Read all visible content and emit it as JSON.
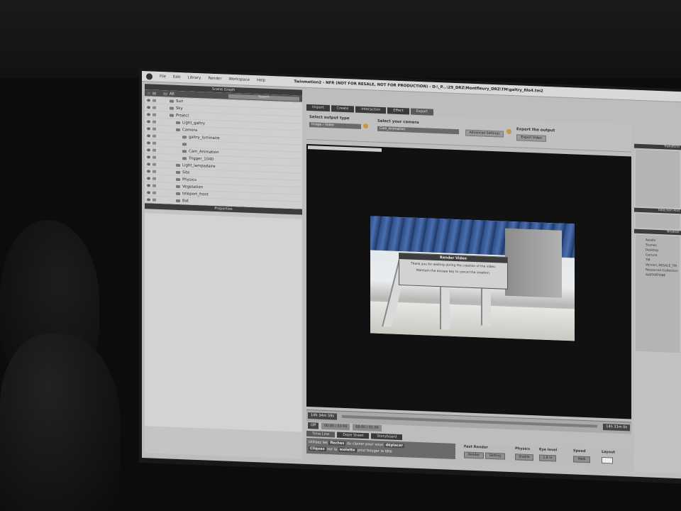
{
  "app": {
    "window_title": "Twinmotion2 - NFR (NOT FOR RESALE, NOT FOR PRODUCTION) - D:\\_P...\\29_DRZ\\Montfleury_DRZ\\TM\\galtry_filo4.tm2"
  },
  "menu": [
    "File",
    "Edit",
    "Library",
    "Render",
    "Workspace",
    "Help"
  ],
  "scene_graph": {
    "title": "Scene Graph",
    "search_placeholder": "Search",
    "items": [
      {
        "label": "All",
        "indent": 0,
        "selected": true
      },
      {
        "label": "Sun",
        "indent": 1
      },
      {
        "label": "Sky",
        "indent": 1
      },
      {
        "label": "Project",
        "indent": 1
      },
      {
        "label": "Light_galtry",
        "indent": 2
      },
      {
        "label": "Camera",
        "indent": 2
      },
      {
        "label": "galtry_luminaire",
        "indent": 3
      },
      {
        "label": "",
        "indent": 3
      },
      {
        "label": "Cam_Animation",
        "indent": 3
      },
      {
        "label": "Trigger_1040",
        "indent": 3
      },
      {
        "label": "Light_lampadaire",
        "indent": 2
      },
      {
        "label": "Site",
        "indent": 2
      },
      {
        "label": "Physics",
        "indent": 2
      },
      {
        "label": "Vegetation",
        "indent": 2
      },
      {
        "label": "teleport_front",
        "indent": 2
      },
      {
        "label": "Bat",
        "indent": 2
      }
    ]
  },
  "properties": {
    "title": "Properties"
  },
  "top_tabs": [
    {
      "label": "Import",
      "active": false
    },
    {
      "label": "Create",
      "active": false
    },
    {
      "label": "Interaction",
      "active": false
    },
    {
      "label": "Effect",
      "active": false
    },
    {
      "label": "Export",
      "active": true
    }
  ],
  "export_options": {
    "output_type_label": "Select output type",
    "output_type_value": "Image / Video",
    "camera_label": "Select your camera",
    "camera_value": "Cam_Animation",
    "advanced_button": "Advanced Settings",
    "export_label": "Export the output",
    "export_button": "Export Video"
  },
  "render_dialog": {
    "title": "Render Video",
    "line1": "Thank you for waiting during the creation of the video.",
    "line2": "Maintain the escape key to cancel the creation."
  },
  "timeline": {
    "start_time": "14h 34m 59s",
    "end_time": "14h 31m 0s",
    "off_label": "Off",
    "marker1": "00:00 / 01:00",
    "marker2": "00:00 / 01:00"
  },
  "bottom_tabs": [
    {
      "label": "Time Line",
      "active": true
    },
    {
      "label": "Dope Sheet",
      "active": false
    },
    {
      "label": "Storyboard",
      "active": false
    }
  ],
  "hints": {
    "line1_a": "Utilisez les",
    "line1_hl": "fleches",
    "line1_b": "du clavier pour vous",
    "line1_hl2": "déplacer",
    "line2_a": "Cliquez",
    "line2_b": "sur la",
    "line2_hl": "molette",
    "line2_c": "pour bouger la tête"
  },
  "fast_render": {
    "title": "Fast Render",
    "render_button": "Render",
    "setting_button": "Setting",
    "physics_label": "Physics",
    "physics_value": "Enable",
    "eye_level_label": "Eye level",
    "eye_level_value": "1.8 m",
    "speed_label": "Speed",
    "speed_value": "Walk",
    "layout_label": "Layout"
  },
  "right_panel": {
    "header_top": "Transform",
    "header_mid": "Selection And",
    "header_lib": "Browser",
    "library_items": [
      "Assets",
      "Scenes",
      "Desktop",
      "Carrure",
      "TM",
      "Version_RESALE_TM",
      "Resources-Collection",
      "AVATARTOBE"
    ]
  }
}
